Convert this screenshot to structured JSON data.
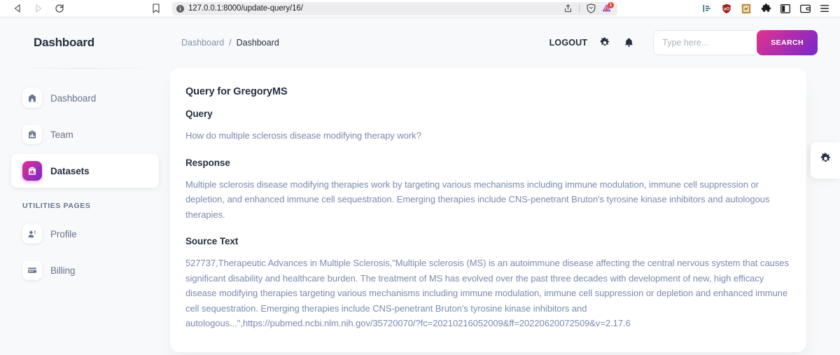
{
  "browser": {
    "back_label": "Back",
    "forward_label": "Forward",
    "reload_label": "Reload",
    "bookmark_label": "Bookmark",
    "url": "127.0.0.1:8000/update-query/16/",
    "site_info_glyph": "i",
    "share_label": "Share",
    "shield_label": "Brave Shields",
    "notification_count": "1",
    "extensions": [
      {
        "name": "sidebar-toggle-icon"
      },
      {
        "name": "ublock-origin-icon"
      },
      {
        "name": "notes-extension-icon"
      },
      {
        "name": "extensions-puzzle-icon"
      },
      {
        "name": "split-view-icon"
      },
      {
        "name": "wallet-icon"
      },
      {
        "name": "browser-menu-icon"
      }
    ]
  },
  "sidebar": {
    "brand": "Dashboard",
    "items": [
      {
        "label": "Dashboard",
        "icon": "home-icon",
        "active": false
      },
      {
        "label": "Team",
        "icon": "office-chart-icon",
        "active": false
      },
      {
        "label": "Datasets",
        "icon": "datasets-chart-icon",
        "active": true
      }
    ],
    "section_title": "UTILITIES PAGES",
    "utility_items": [
      {
        "label": "Profile",
        "icon": "profile-person-icon",
        "active": false
      },
      {
        "label": "Billing",
        "icon": "credit-card-icon",
        "active": false
      }
    ]
  },
  "topbar": {
    "breadcrumb_parent": "Dashboard",
    "breadcrumb_separator": "/",
    "breadcrumb_current": "Dashboard",
    "logout_label": "LOGOUT",
    "settings_icon": "gear-icon",
    "notifications_icon": "bell-icon",
    "search_placeholder": "Type here...",
    "search_value": "",
    "search_button_label": "SEARCH"
  },
  "card": {
    "title": "Query for GregoryMS",
    "query_heading": "Query",
    "query_text": "How do multiple sclerosis disease modifying therapy work?",
    "response_heading": "Response",
    "response_text": "Multiple sclerosis disease modifying therapies work by targeting various mechanisms including immune modulation, immune cell suppression or depletion, and enhanced immune cell sequestration. Emerging therapies include CNS-penetrant Bruton's tyrosine kinase inhibitors and autologous therapies.",
    "source_heading": "Source Text",
    "source_text": "527737,Therapeutic Advances in Multiple Sclerosis,\"Multiple sclerosis (MS) is an autoimmune disease affecting the central nervous system that causes significant disability and healthcare burden. The treatment of MS has evolved over the past three decades with development of new, high efficacy disease modifying therapies targeting various mechanisms including immune modulation, immune cell suppression or depletion and enhanced immune cell sequestration. Emerging therapies include CNS-penetrant Bruton's tyrosine kinase inhibitors and autologous...\",https://pubmed.ncbi.nlm.nih.gov/35720070/?fc=20210216052009&ff=20220620072509&v=2.17.6"
  },
  "fixed_plugin": {
    "icon": "gear-icon",
    "label": "Settings"
  },
  "colors": {
    "accent_start": "#e0338f",
    "accent_end": "#7928ca",
    "text_dark": "#252f40",
    "text_muted": "#67748e",
    "body_text": "#7b8ab0",
    "page_bg": "#f8f9fa",
    "badge_red": "#e8453c"
  }
}
